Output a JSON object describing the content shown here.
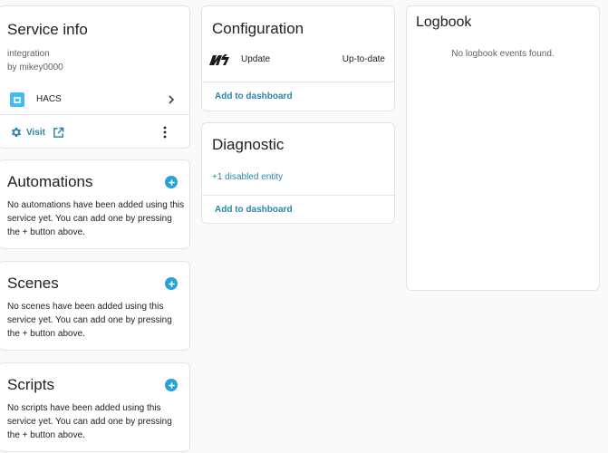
{
  "service_info": {
    "title": "Service info",
    "type": "integration",
    "author": "by mikey0000",
    "integration_name": "HACS",
    "visit_label": "Visit"
  },
  "automations": {
    "title": "Automations",
    "text": "No automations have been added using this service yet. You can add one by pressing the + button above."
  },
  "scenes": {
    "title": "Scenes",
    "text": "No scenes have been added using this service yet. You can add one by pressing the + button above."
  },
  "scripts": {
    "title": "Scripts",
    "text": "No scripts have been added using this service yet. You can add one by pressing the + button above."
  },
  "configuration": {
    "title": "Configuration",
    "entity_name": "Update",
    "entity_state": "Up-to-date",
    "add_label": "Add to dashboard"
  },
  "diagnostic": {
    "title": "Diagnostic",
    "disabled_label": "+1 disabled entity",
    "add_label": "Add to dashboard"
  },
  "logbook": {
    "title": "Logbook",
    "empty_text": "No logbook events found."
  },
  "colors": {
    "accent": "#2b86a8",
    "plus_button": "#2aa3d3",
    "hacs_icon": "#41bdf5"
  }
}
